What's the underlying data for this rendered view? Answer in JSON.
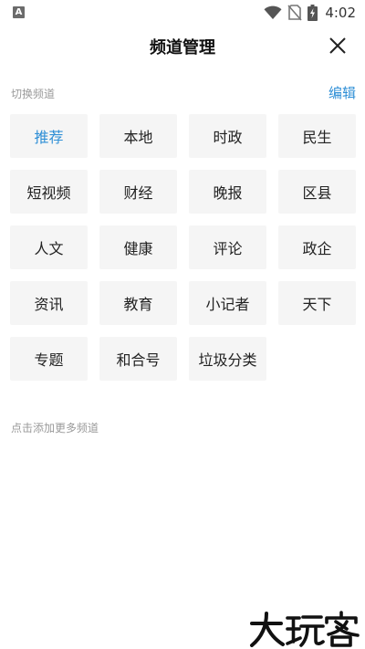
{
  "status_bar": {
    "time": "4:02",
    "badge": "A",
    "icons": [
      "wifi-icon",
      "no-sim-icon",
      "battery-charging-icon"
    ]
  },
  "header": {
    "title": "频道管理",
    "close_icon": "close-icon"
  },
  "section": {
    "label": "切换频道",
    "edit_label": "编辑"
  },
  "channels": [
    {
      "label": "推荐",
      "active": true
    },
    {
      "label": "本地",
      "active": false
    },
    {
      "label": "时政",
      "active": false
    },
    {
      "label": "民生",
      "active": false
    },
    {
      "label": "短视频",
      "active": false
    },
    {
      "label": "财经",
      "active": false
    },
    {
      "label": "晚报",
      "active": false
    },
    {
      "label": "区县",
      "active": false
    },
    {
      "label": "人文",
      "active": false
    },
    {
      "label": "健康",
      "active": false
    },
    {
      "label": "评论",
      "active": false
    },
    {
      "label": "政企",
      "active": false
    },
    {
      "label": "资讯",
      "active": false
    },
    {
      "label": "教育",
      "active": false
    },
    {
      "label": "小记者",
      "active": false
    },
    {
      "label": "天下",
      "active": false
    },
    {
      "label": "专题",
      "active": false
    },
    {
      "label": "和合号",
      "active": false
    },
    {
      "label": "垃圾分类",
      "active": false
    }
  ],
  "more": {
    "label": "点击添加更多频道"
  },
  "watermark": {
    "text": "大玩客"
  },
  "colors": {
    "accent": "#2f8fd6",
    "chip_bg": "#f5f5f5",
    "muted": "#9a9a9a"
  }
}
